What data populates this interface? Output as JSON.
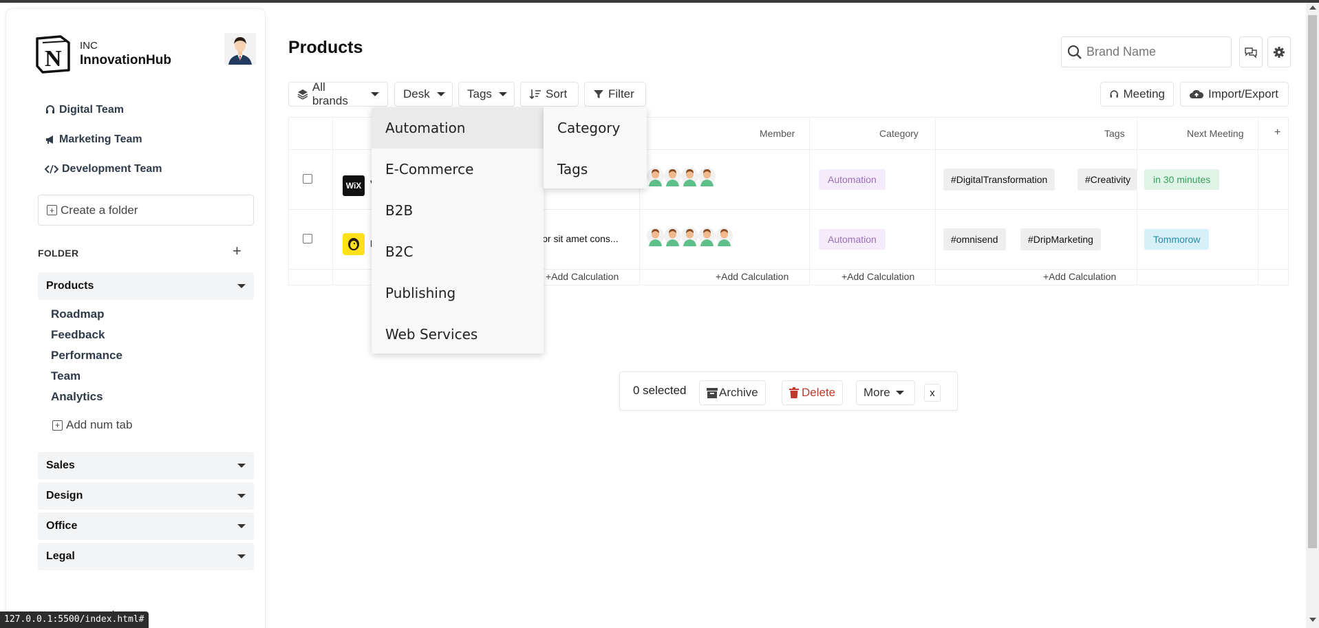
{
  "brand": {
    "inc": "INC",
    "name": "InnovationHub"
  },
  "teams": [
    {
      "label": "Digital Team",
      "icon": "headset-icon"
    },
    {
      "label": "Marketing Team",
      "icon": "megaphone-icon"
    },
    {
      "label": "Development Team",
      "icon": "code-icon"
    }
  ],
  "sidebar": {
    "create_folder": "Create a folder",
    "folder_label": "FOLDER",
    "folder_add": "+",
    "sections": [
      "Products",
      "Sales",
      "Design",
      "Office",
      "Legal"
    ],
    "sub_items": [
      "Roadmap",
      "Feedback",
      "Performance",
      "Team",
      "Analytics"
    ],
    "add_num_tab": "Add num tab",
    "bottom_partial": "ates"
  },
  "url_tooltip": "127.0.0.1:5500/index.html#",
  "main": {
    "title": "Products",
    "search_placeholder": "Brand Name",
    "toolbar": {
      "all_brands": "All brands",
      "desk": "Desk",
      "tags": "Tags",
      "sort": "Sort",
      "filter": "Filter",
      "meeting": "Meeting",
      "import_export": "Import/Export"
    }
  },
  "table": {
    "headers": {
      "member": "Member",
      "category": "Category",
      "tags": "Tags",
      "next_meeting": "Next Meeting",
      "add_col": "+"
    },
    "rows": [
      {
        "logo": "WiX",
        "partial_name": "V",
        "members": 4,
        "category": "Automation",
        "tags": [
          "#DigitalTransformation",
          "#Creativity"
        ],
        "meeting": "in 30 minutes"
      },
      {
        "logo": "mailchimp",
        "partial_name": "I",
        "description": "lor sit amet cons...",
        "members": 5,
        "category": "Automation",
        "tags": [
          "#omnisend",
          "#DripMarketing"
        ],
        "meeting": "Tommorow"
      }
    ],
    "add_calc": "+Add Calculation"
  },
  "dropdown": {
    "items": [
      "Automation",
      "E-Commerce",
      "B2B",
      "B2C",
      "Publishing",
      "Web Services"
    ],
    "side_items": [
      "Category",
      "Tags"
    ]
  },
  "selection": {
    "count": "0 selected",
    "archive": "Archive",
    "delete": "Delete",
    "more": "More",
    "close": "x"
  },
  "colors": {
    "accent_purple": "#9a6fb5",
    "green": "#3a9c5a",
    "blue": "#2b8aa6",
    "delete_red": "#c0392b"
  }
}
